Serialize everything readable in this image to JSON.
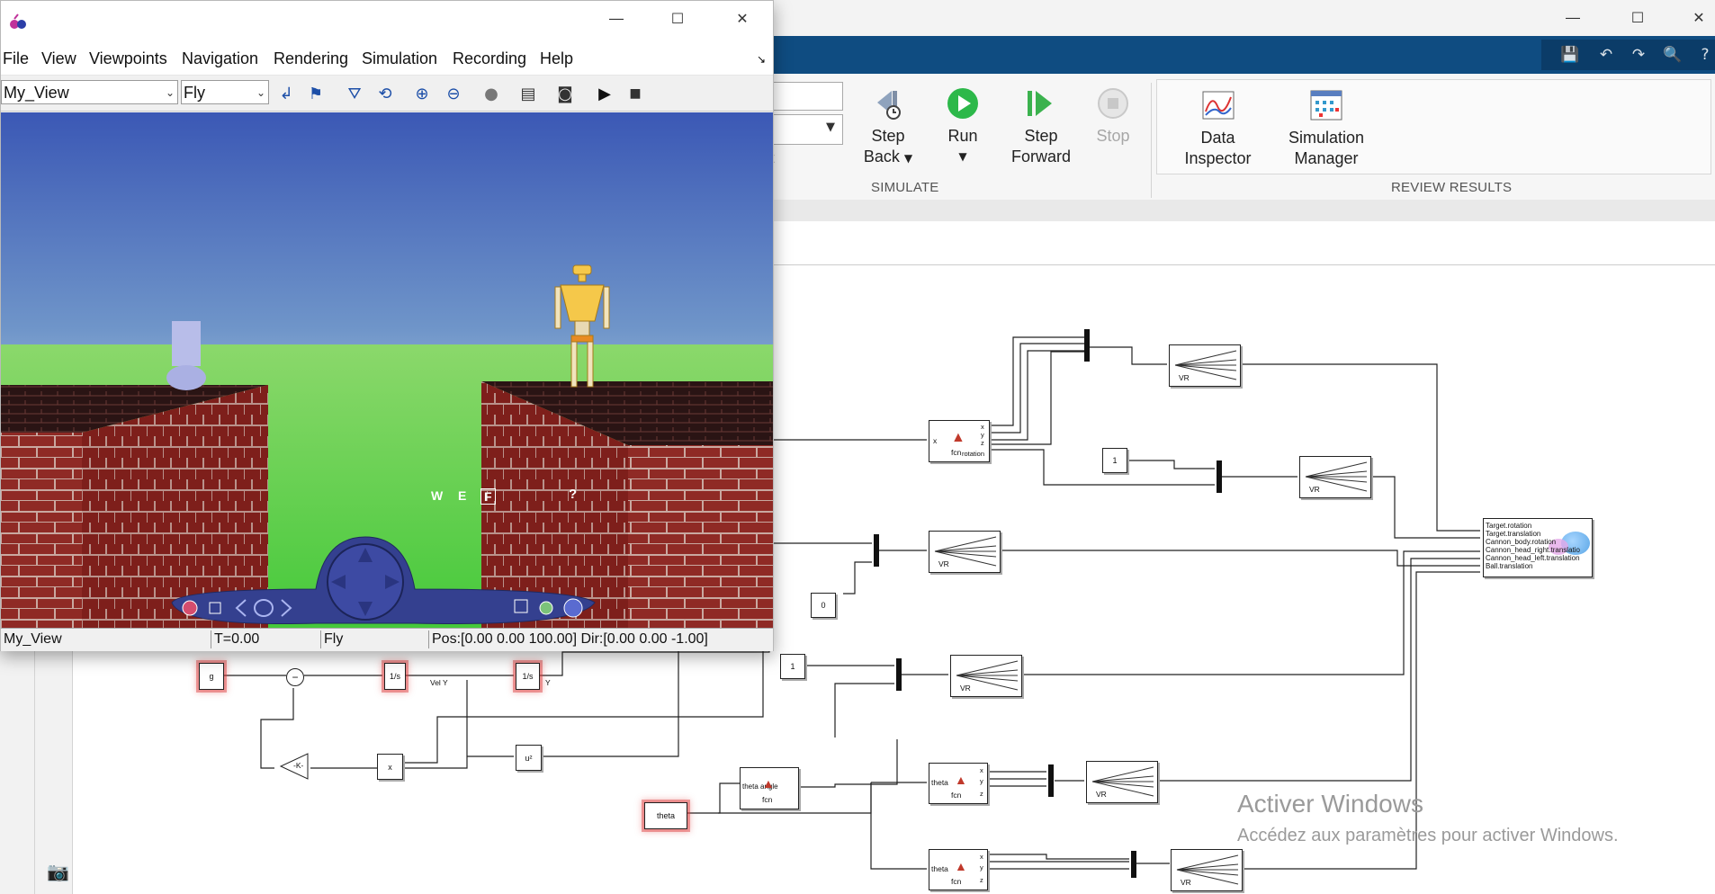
{
  "simulink": {
    "ribbon": {
      "step_back": [
        "Step",
        "Back"
      ],
      "run": "Run",
      "step_forward": [
        "Step",
        "Forward"
      ],
      "stop": "Stop",
      "data_inspector": [
        "Data",
        "Inspector"
      ],
      "simulation_manager": [
        "Simulation",
        "Manager"
      ],
      "section_simulate": "SIMULATE",
      "section_review": "REVIEW RESULTS",
      "partial_text": "t"
    },
    "blocks": {
      "g": "g",
      "integrator": "1/s",
      "vel_y": "Vel Y",
      "y": "Y",
      "gain": "-K-",
      "product": "x",
      "square": "u²",
      "theta": "theta",
      "fcn": "fcn",
      "fcn_rotation": "rotation",
      "fcn_angle_label": "theta  angle",
      "fcn_theta": "theta",
      "port_x": "x",
      "port_y": "y",
      "port_z": "z",
      "const1": "1",
      "const0": "0",
      "vr": "VR",
      "vr_sink_ports": [
        "Target.rotation",
        "Target.translation",
        "Cannon_body.rotation",
        "Cannon_head_right.translatio",
        "Cannon_head_left.translation",
        "Ball.translation"
      ]
    },
    "watermark": {
      "title": "Activer Windows",
      "subtitle": "Accédez aux paramètres pour activer Windows."
    },
    "colors": {
      "tabstrip": "#0f4c81",
      "highlight": "#dc3c3c"
    }
  },
  "vr_viewer": {
    "menu": [
      "File",
      "View",
      "Viewpoints",
      "Navigation",
      "Rendering",
      "Simulation",
      "Recording",
      "Help"
    ],
    "toolbar": {
      "viewpoint_value": "My_View",
      "nav_mode_value": "Fly",
      "icons": [
        "back-icon",
        "flag-icon",
        "straighten-icon",
        "reset-icon",
        "zoom-in-icon",
        "zoom-out-icon",
        "record-dot-icon",
        "notes-icon",
        "camera-icon",
        "play-icon",
        "stop-icon"
      ]
    },
    "nav_panel": {
      "w": "W",
      "e": "E",
      "f": "F",
      "help": "?"
    },
    "status": {
      "view": "My_View",
      "time": "T=0.00",
      "mode": "Fly",
      "pos": "Pos:[0.00 0.00 100.00] Dir:[0.00 0.00 -1.00]"
    },
    "colors": {
      "sky_top": "#3b58b5",
      "sky_bottom": "#a9c4dd",
      "grass": "#45c93a",
      "brick": "#8f2a25"
    }
  }
}
